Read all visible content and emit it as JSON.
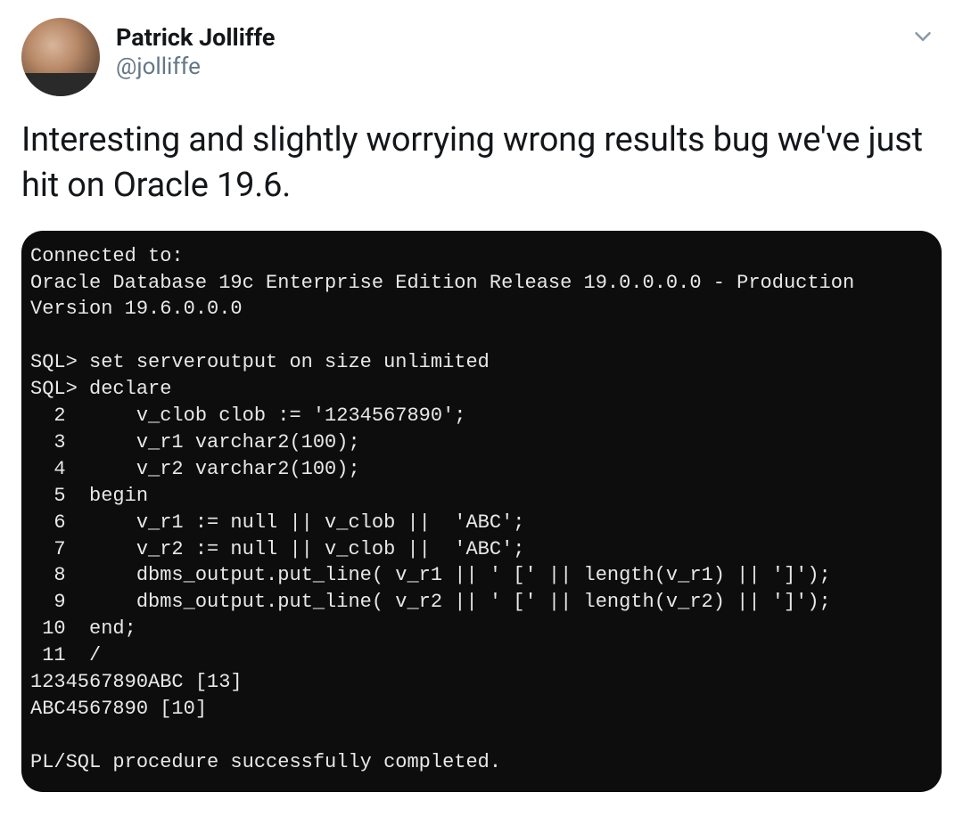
{
  "user": {
    "display_name": "Patrick Jolliffe",
    "handle": "@jolliffe"
  },
  "tweet_text": "Interesting and slightly worrying wrong results bug we've just hit on Oracle 19.6.",
  "code_lines": [
    "Connected to:",
    "Oracle Database 19c Enterprise Edition Release 19.0.0.0.0 - Production",
    "Version 19.6.0.0.0",
    "",
    "SQL> set serveroutput on size unlimited",
    "SQL> declare",
    "  2      v_clob clob := '1234567890';",
    "  3      v_r1 varchar2(100);",
    "  4      v_r2 varchar2(100);",
    "  5  begin",
    "  6      v_r1 := null || v_clob ||  'ABC';",
    "  7      v_r2 := null || v_clob ||  'ABC';",
    "  8      dbms_output.put_line( v_r1 || ' [' || length(v_r1) || ']');",
    "  9      dbms_output.put_line( v_r2 || ' [' || length(v_r2) || ']');",
    " 10  end;",
    " 11  /",
    "1234567890ABC [13]",
    "ABC4567890 [10]",
    "",
    "PL/SQL procedure successfully completed."
  ]
}
